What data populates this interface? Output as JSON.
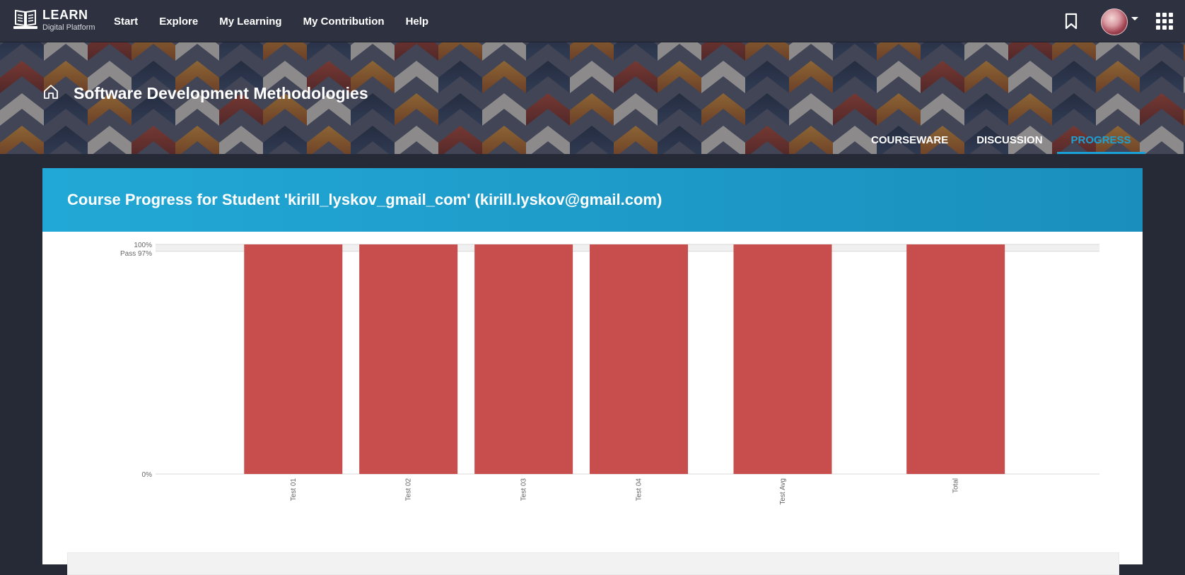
{
  "brand": {
    "title": "LEARN",
    "subtitle": "Digital Platform",
    "icon": "open-book-icon"
  },
  "nav": [
    {
      "label": "Start"
    },
    {
      "label": "Explore"
    },
    {
      "label": "My Learning"
    },
    {
      "label": "My Contribution"
    },
    {
      "label": "Help"
    }
  ],
  "header_icons": {
    "bookmark": "bookmark-icon",
    "apps": "apps-grid-icon",
    "avatar": "user-avatar"
  },
  "course": {
    "title": "Software Development Methodologies",
    "home_icon": "home-icon"
  },
  "tabs": [
    {
      "label": "COURSEWARE",
      "active": false
    },
    {
      "label": "DISCUSSION",
      "active": false
    },
    {
      "label": "PROGRESS",
      "active": true
    }
  ],
  "progress": {
    "heading": "Course Progress for Student 'kirill_lyskov_gmail_com' (kirill.lyskov@gmail.com)"
  },
  "colors": {
    "accent": "#1aa1d6",
    "bar": "#c84d4d",
    "header_bg": "#2e3240"
  },
  "chart_data": {
    "type": "bar",
    "categories": [
      "Test 01",
      "Test 02",
      "Test 03",
      "Test 04",
      "Test Avg",
      "Total"
    ],
    "values": [
      100,
      100,
      100,
      100,
      100,
      100
    ],
    "unit": "%",
    "ylim": [
      0,
      100
    ],
    "yticks": [
      {
        "value": 100,
        "label": "100%"
      },
      {
        "value": 97,
        "label": "Pass 97%"
      },
      {
        "value": 0,
        "label": "0%"
      }
    ],
    "pass_threshold": 97,
    "title": "",
    "xlabel": "",
    "ylabel": "",
    "grid": true,
    "legend": "none"
  }
}
